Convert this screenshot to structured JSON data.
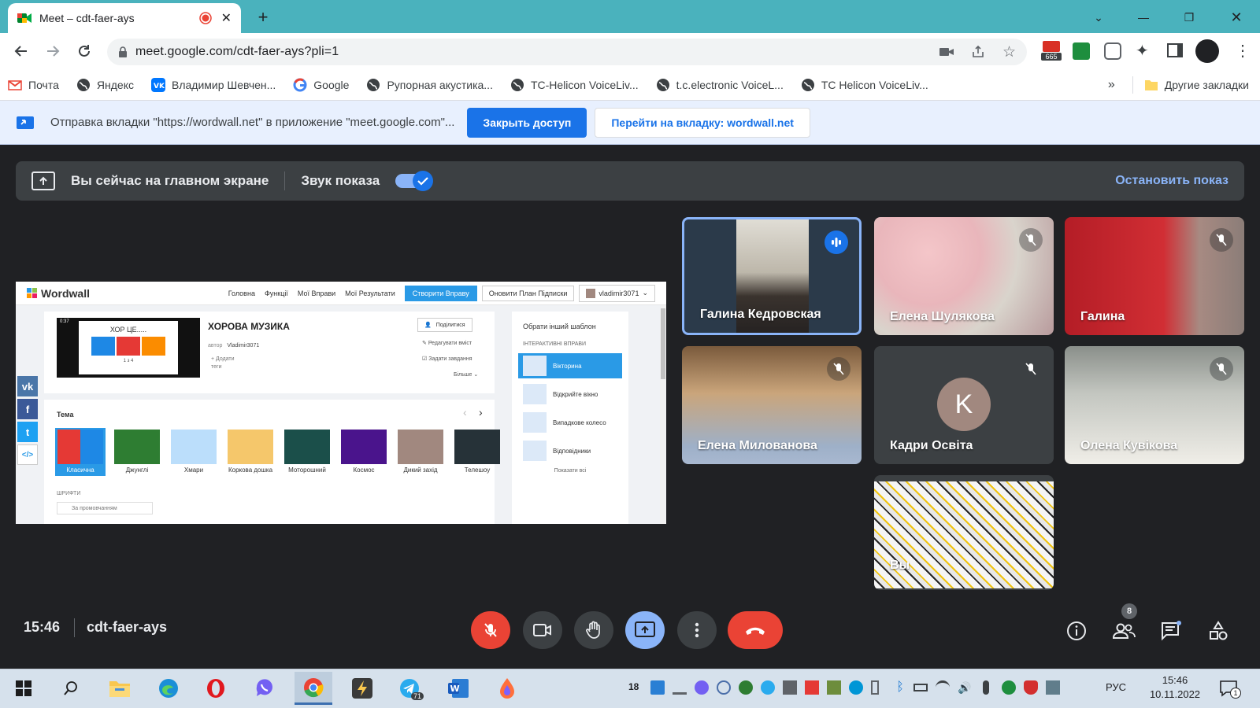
{
  "browser": {
    "tab_title": "Meet – cdt-faer-ays",
    "url": "meet.google.com/cdt-faer-ays?pli=1",
    "bookmarks": [
      {
        "label": "Почта",
        "icon": "gmail-icon"
      },
      {
        "label": "Яндекс",
        "icon": "globe-icon"
      },
      {
        "label": "Владимир Шевчен...",
        "icon": "vk-icon"
      },
      {
        "label": "Google",
        "icon": "google-icon"
      },
      {
        "label": "Рупорная акустика...",
        "icon": "globe-icon"
      },
      {
        "label": "TC-Helicon VoiceLiv...",
        "icon": "globe-icon"
      },
      {
        "label": "t.c.electronic VoiceL...",
        "icon": "globe-icon"
      },
      {
        "label": "TC Helicon VoiceLiv...",
        "icon": "globe-icon"
      }
    ],
    "bookmarks_more": "»",
    "other_bookmarks": "Другие закладки",
    "extension_badge": "665"
  },
  "infobar": {
    "message": "Отправка вкладки \"https://wordwall.net\" в приложение \"meet.google.com\"...",
    "stop_button": "Закрыть доступ",
    "goto_button": "Перейти на вкладку: wordwall.net"
  },
  "presentation": {
    "status": "Вы сейчас на главном экране",
    "audio_label": "Звук показа",
    "audio_enabled": true,
    "stop_label": "Остановить показ"
  },
  "shared_screen": {
    "logo": "Wordwall",
    "nav": [
      "Головна",
      "Функції",
      "Мої Вправи",
      "Мої Результати"
    ],
    "create_button": "Створити Вправу",
    "upgrade_button": "Оновити План Підписки",
    "user": "vladimir3071",
    "activity_title": "ХОРОВА МУЗИКА",
    "thumb_title": "ХОР ЦЕ.....",
    "thumb_time": "0:37",
    "thumb_page": "1 з 4",
    "author_label": "автор",
    "author": "Vladimir3071",
    "add_tags": "Додати",
    "tags_label": "теги",
    "share_button": "Поділитися",
    "edit_content": "Редагувати вміст",
    "set_task": "Задати завдання",
    "more": "Більше",
    "theme_label": "Тема",
    "fonts_label": "ШРИФТИ",
    "font_value": "За промовчанням",
    "themes": [
      "Класична",
      "Джунглі",
      "Хмари",
      "Коркова дошка",
      "Моторошний",
      "Космос",
      "Дикий захід",
      "Телешоу"
    ],
    "template_title": "Обрати інший шаблон",
    "interactive_label": "ІНТЕРАКТИВНІ ВПРАВИ",
    "templates": [
      "Вікторина",
      "Відкрийте вікно",
      "Випадкове колесо",
      "Відповідники"
    ],
    "show_all": "Показати всі"
  },
  "participants": [
    {
      "name": "Галина Кедровская",
      "speaking": true
    },
    {
      "name": "Елена Шулякова",
      "muted": true
    },
    {
      "name": "Галина",
      "muted": true
    },
    {
      "name": "Елена Милованова",
      "muted": true
    },
    {
      "name": "Кадри Освіта",
      "muted": true,
      "initial": "K"
    },
    {
      "name": "Олена Кувікова",
      "muted": true
    },
    {
      "name": "Вы"
    }
  ],
  "footer": {
    "time": "15:46",
    "meeting_code": "cdt-faer-ays",
    "participant_count": "8"
  },
  "taskbar": {
    "telegram_badge": "71",
    "tray_badge": "18",
    "language": "РУС",
    "time": "15:46",
    "date": "10.11.2022",
    "notifications": "1"
  },
  "colors": {
    "chrome_tab_bar": "#4ab2bd",
    "meet_background": "#202124",
    "meet_blue": "#8ab4f8",
    "hangup_red": "#ea4335",
    "wordwall_blue": "#2a9ae6"
  }
}
